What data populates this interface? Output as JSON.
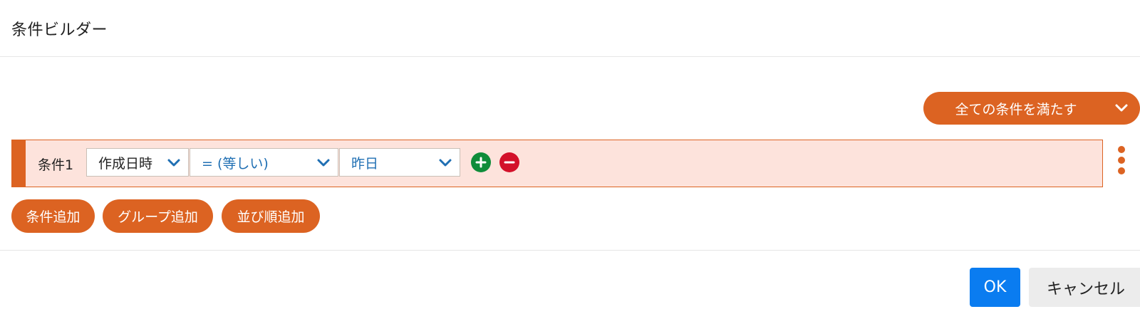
{
  "header": {
    "title": "条件ビルダー"
  },
  "match": {
    "label": "全ての条件を満たす",
    "icon": "chevron-down-icon"
  },
  "condition": {
    "label": "条件1",
    "field": "作成日時",
    "operator": "= (等しい)",
    "value": "昨日",
    "add_icon": "plus-circle-icon",
    "remove_icon": "minus-circle-icon",
    "menu_icon": "kebab-menu-icon"
  },
  "actions": {
    "add_condition": "条件追加",
    "add_group": "グループ追加",
    "add_sort": "並び順追加"
  },
  "footer": {
    "ok": "OK",
    "cancel": "キャンセル"
  },
  "colors": {
    "accent": "#dc6322",
    "row_background": "#fde3dc",
    "add": "#0f8c3a",
    "remove": "#d3112a",
    "primary": "#0a7cf0",
    "link_text": "#1f6fb3"
  }
}
